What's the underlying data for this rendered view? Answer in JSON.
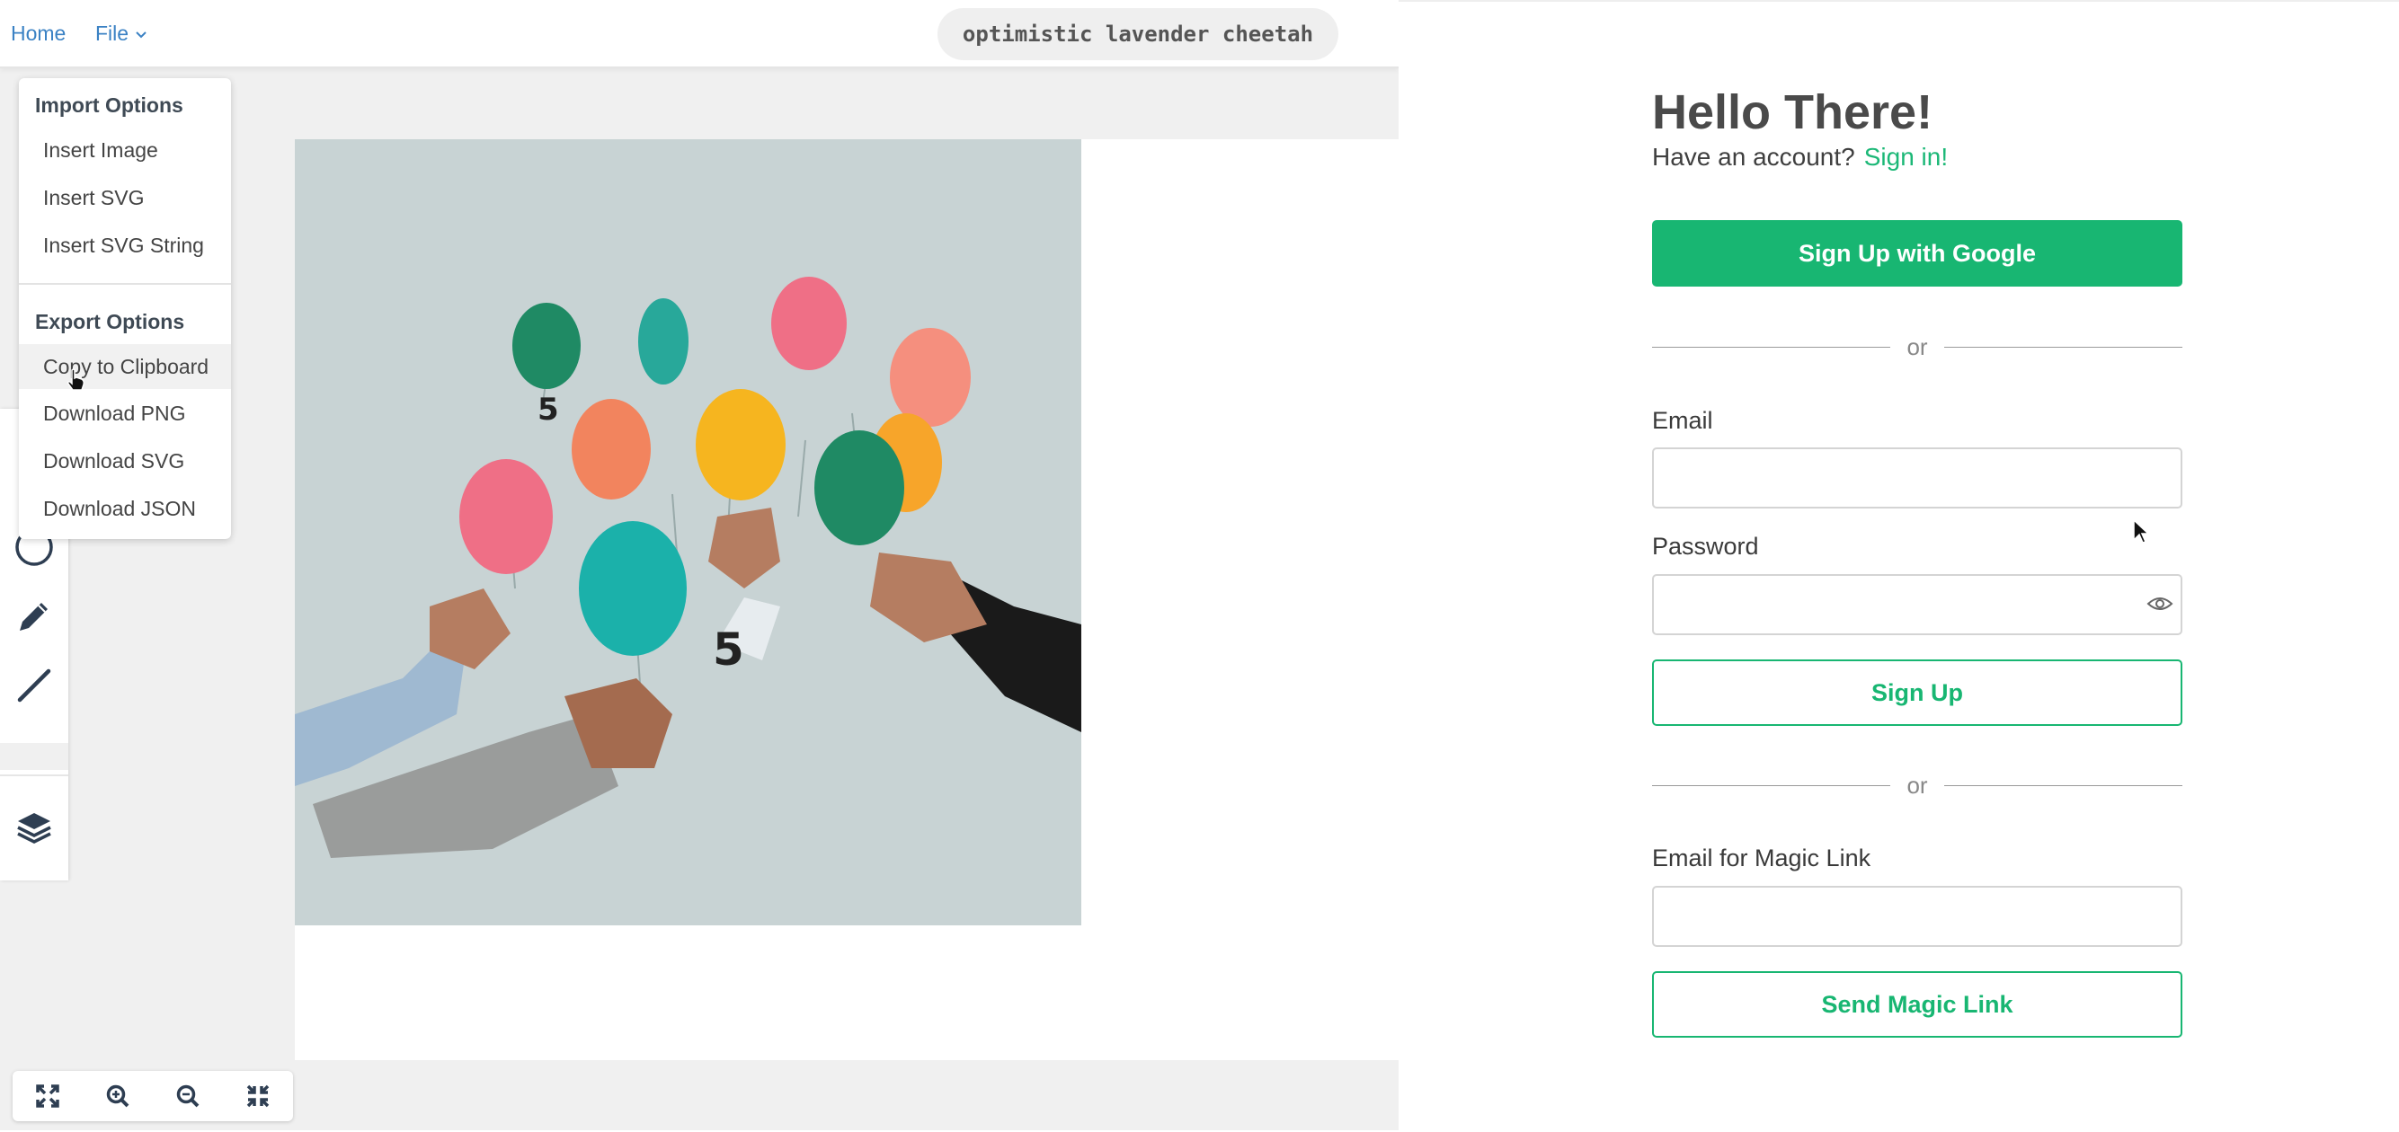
{
  "nav": {
    "home_label": "Home",
    "file_label": "File",
    "project_name": "optimistic lavender cheetah"
  },
  "file_menu": {
    "import_heading": "Import Options",
    "import_items": [
      "Insert Image",
      "Insert SVG",
      "Insert SVG String"
    ],
    "export_heading": "Export Options",
    "export_items": [
      "Copy to Clipboard",
      "Download PNG",
      "Download SVG",
      "Download JSON"
    ],
    "hovered_item": "Copy to Clipboard"
  },
  "toolbar": {
    "tools": [
      "rectangle-icon",
      "circle-icon",
      "pencil-icon",
      "line-icon",
      "layers-icon"
    ]
  },
  "zoom_controls": [
    "fit-screen-icon",
    "zoom-in-icon",
    "zoom-out-icon",
    "shrink-icon"
  ],
  "signup": {
    "title": "Hello There!",
    "have_account": "Have an account?",
    "signin_link": "Sign in!",
    "google_button": "Sign Up with Google",
    "or_1": "or",
    "email_label": "Email",
    "email_value": "",
    "password_label": "Password",
    "password_value": "",
    "signup_button": "Sign Up",
    "or_2": "or",
    "magic_email_label": "Email for Magic Link",
    "magic_email_value": "",
    "magic_button": "Send Magic Link"
  },
  "colors": {
    "accent_green": "#18b672",
    "link_blue": "#3b82c4",
    "artwork_background": "#c8d3d4"
  }
}
